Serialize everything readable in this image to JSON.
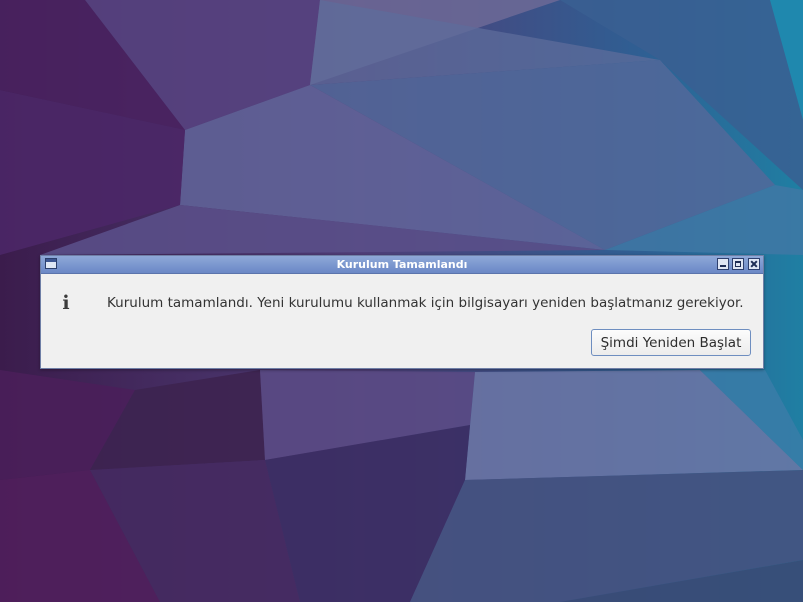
{
  "wallpaper": {
    "colors": [
      "#3a1f4f",
      "#4a2a66",
      "#5a3a78",
      "#3e4f86",
      "#2f6c9a",
      "#1f86a6"
    ]
  },
  "dialog": {
    "title": "Kurulum Tamamlandı",
    "window_buttons": [
      "minimize-icon",
      "maximize-icon",
      "close-icon"
    ],
    "icon": "info-icon",
    "icon_glyph": "i",
    "message": "Kurulum tamamlandı. Yeni kurulumu kullanmak için bilgisayarı yeniden başlatmanız gerekiyor.",
    "restart_button_label": "Şimdi Yeniden Başlat"
  }
}
